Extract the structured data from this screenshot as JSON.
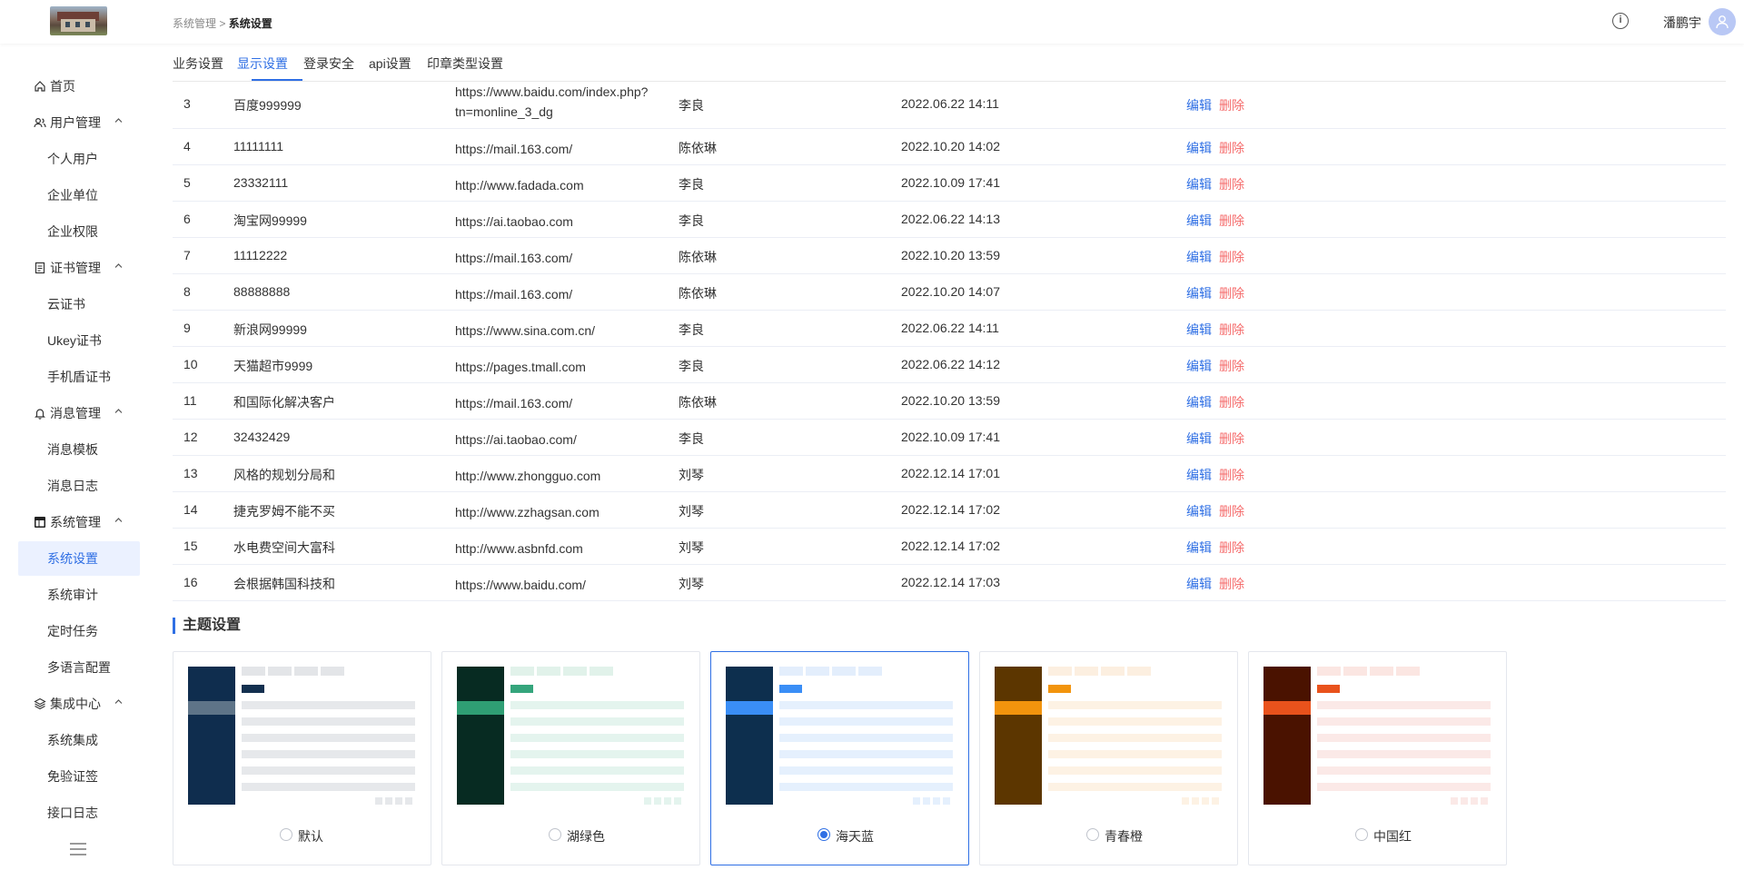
{
  "header": {
    "breadcrumb_parent": "系统管理",
    "breadcrumb_sep": " > ",
    "breadcrumb_current": "系统设置",
    "info_icon": "i",
    "username": "潘鹏宇"
  },
  "sidebar": {
    "items": [
      {
        "label": "首页",
        "type": "group",
        "icon": "home-icon"
      },
      {
        "label": "用户管理",
        "type": "group",
        "icon": "users-icon",
        "chevron": "^"
      },
      {
        "label": "个人用户",
        "type": "sub"
      },
      {
        "label": "企业单位",
        "type": "sub"
      },
      {
        "label": "企业权限",
        "type": "sub"
      },
      {
        "label": "证书管理",
        "type": "group",
        "icon": "document-icon",
        "chevron": "^"
      },
      {
        "label": "云证书",
        "type": "sub"
      },
      {
        "label": "Ukey证书",
        "type": "sub"
      },
      {
        "label": "手机盾证书",
        "type": "sub"
      },
      {
        "label": "消息管理",
        "type": "group",
        "icon": "bell-icon",
        "chevron": "^"
      },
      {
        "label": "消息模板",
        "type": "sub"
      },
      {
        "label": "消息日志",
        "type": "sub"
      },
      {
        "label": "系统管理",
        "type": "group",
        "icon": "layout-icon",
        "chevron": "^"
      },
      {
        "label": "系统设置",
        "type": "sub",
        "active": true
      },
      {
        "label": "系统审计",
        "type": "sub"
      },
      {
        "label": "定时任务",
        "type": "sub"
      },
      {
        "label": "多语言配置",
        "type": "sub"
      },
      {
        "label": "集成中心",
        "type": "group",
        "icon": "layers-icon",
        "chevron": "^"
      },
      {
        "label": "系统集成",
        "type": "sub"
      },
      {
        "label": "免验证签",
        "type": "sub"
      },
      {
        "label": "接口日志",
        "type": "sub"
      }
    ]
  },
  "tabs": [
    "业务设置",
    "显示设置",
    "登录安全",
    "api设置",
    "印章类型设置"
  ],
  "active_tab": "显示设置",
  "table": {
    "edit_label": "编辑",
    "delete_label": "删除",
    "rows": [
      {
        "idx": "3",
        "name": "百度999999",
        "url": "https://www.baidu.com/index.php?tn=monline_3_dg",
        "user": "李良",
        "time": "2022.06.22 14:11"
      },
      {
        "idx": "4",
        "name": "11111111",
        "url": "https://mail.163.com/",
        "user": "陈依琳",
        "time": "2022.10.20 14:02"
      },
      {
        "idx": "5",
        "name": "23332111",
        "url": "http://www.fadada.com",
        "user": "李良",
        "time": "2022.10.09 17:41"
      },
      {
        "idx": "6",
        "name": "淘宝网99999",
        "url": "https://ai.taobao.com",
        "user": "李良",
        "time": "2022.06.22 14:13"
      },
      {
        "idx": "7",
        "name": "11112222",
        "url": "https://mail.163.com/",
        "user": "陈依琳",
        "time": "2022.10.20 13:59"
      },
      {
        "idx": "8",
        "name": "88888888",
        "url": "https://mail.163.com/",
        "user": "陈依琳",
        "time": "2022.10.20 14:07"
      },
      {
        "idx": "9",
        "name": "新浪网99999",
        "url": "https://www.sina.com.cn/",
        "user": "李良",
        "time": "2022.06.22 14:11"
      },
      {
        "idx": "10",
        "name": "天猫超市9999",
        "url": "https://pages.tmall.com",
        "user": "李良",
        "time": "2022.06.22 14:12"
      },
      {
        "idx": "11",
        "name": "和国际化解决客户",
        "url": "https://mail.163.com/",
        "user": "陈依琳",
        "time": "2022.10.20 13:59"
      },
      {
        "idx": "12",
        "name": "32432429",
        "url": "https://ai.taobao.com/",
        "user": "李良",
        "time": "2022.10.09 17:41"
      },
      {
        "idx": "13",
        "name": "风格的规划分局和",
        "url": "http://www.zhongguo.com",
        "user": "刘琴",
        "time": "2022.12.14 17:01"
      },
      {
        "idx": "14",
        "name": "捷克罗姆不能不买",
        "url": "http://www.zzhagsan.com",
        "user": "刘琴",
        "time": "2022.12.14 17:02"
      },
      {
        "idx": "15",
        "name": "水电费空间大富科",
        "url": "http://www.asbnfd.com",
        "user": "刘琴",
        "time": "2022.12.14 17:02"
      },
      {
        "idx": "16",
        "name": "会根据韩国科技和",
        "url": "https://www.baidu.com/",
        "user": "刘琴",
        "time": "2022.12.14 17:03"
      }
    ]
  },
  "theme_section": {
    "title": "主题设置",
    "themes": [
      {
        "label": "默认",
        "side": "#0f2d4e",
        "bar": "#5e7488",
        "accent": "#13304f",
        "light": "#e6e8eb",
        "pill": "#e3e5e8",
        "selected": false
      },
      {
        "label": "湖绿色",
        "side": "#072b22",
        "bar": "#2f9e74",
        "accent": "#35a57c",
        "light": "#e4f4ee",
        "pill": "#e1f2ea",
        "selected": false
      },
      {
        "label": "海天蓝",
        "side": "#0d2f4e",
        "bar": "#3a8ef6",
        "accent": "#3a8ef6",
        "light": "#e5f0fd",
        "pill": "#e3eefc",
        "selected": true
      },
      {
        "label": "青春橙",
        "side": "#5c3600",
        "bar": "#f2940d",
        "accent": "#f2940d",
        "light": "#fdf2e4",
        "pill": "#fcefe0",
        "selected": false
      },
      {
        "label": "中国红",
        "side": "#4a1200",
        "bar": "#e9521c",
        "accent": "#e9521c",
        "light": "#fbe9e7",
        "pill": "#fbe6e2",
        "selected": false
      }
    ]
  }
}
